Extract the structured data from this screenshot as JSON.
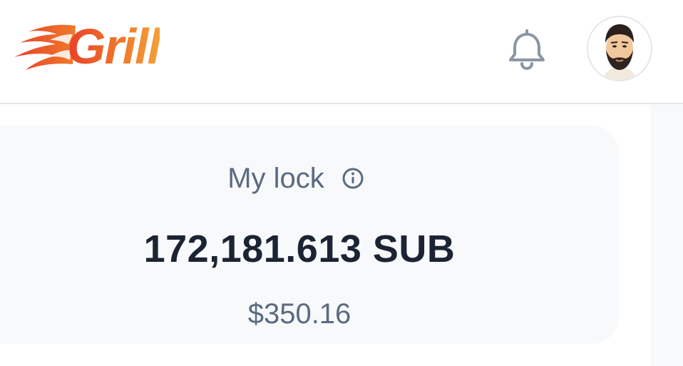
{
  "header": {
    "logo_text": "Grill",
    "notification_icon": "bell-icon",
    "avatar_icon": "user-avatar"
  },
  "lock_card": {
    "title": "My lock",
    "info_icon": "info-icon",
    "amount": "172,181.613 SUB",
    "usd_value": "$350.16"
  },
  "colors": {
    "brand_start": "#e8402a",
    "brand_end": "#f3a03a",
    "text_primary": "#1c2333",
    "text_secondary": "#5b6b80",
    "card_bg": "#f7f9fb",
    "icon": "#8b95a5"
  }
}
